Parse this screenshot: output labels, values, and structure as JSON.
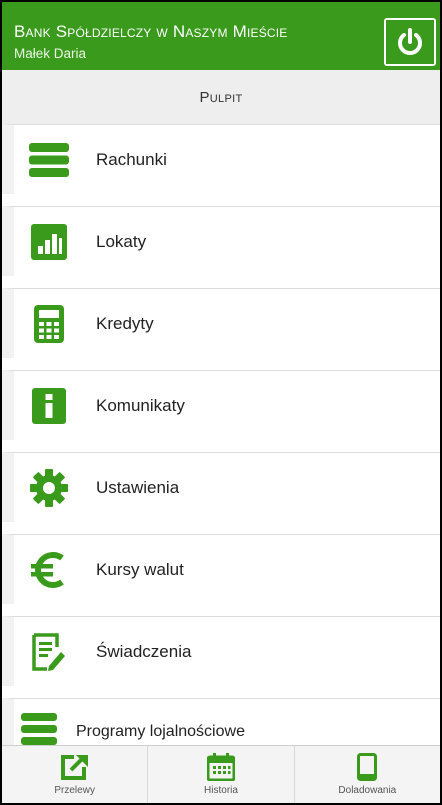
{
  "header": {
    "bank_name": "Bank Spółdzielczy w Naszym Mieście",
    "user_name": "Małek Daria",
    "logout_icon": "power-icon"
  },
  "section": {
    "title": "Pulpit"
  },
  "menu": [
    {
      "label": "Rachunki",
      "icon": "list-icon"
    },
    {
      "label": "Lokaty",
      "icon": "bar-chart-icon"
    },
    {
      "label": "Kredyty",
      "icon": "calculator-icon"
    },
    {
      "label": "Komunikaty",
      "icon": "info-icon"
    },
    {
      "label": "Ustawienia",
      "icon": "gear-icon"
    },
    {
      "label": "Kursy walut",
      "icon": "euro-icon"
    },
    {
      "label": "Świadczenia",
      "icon": "document-edit-icon"
    },
    {
      "label": "Programy lojalnościowe",
      "icon": "list-icon"
    }
  ],
  "bottom_nav": [
    {
      "label": "Przelewy",
      "icon": "transfer-icon"
    },
    {
      "label": "Historia",
      "icon": "calendar-icon"
    },
    {
      "label": "Doladowania",
      "icon": "phone-icon"
    }
  ],
  "colors": {
    "brand_green": "#3a9a1c"
  }
}
